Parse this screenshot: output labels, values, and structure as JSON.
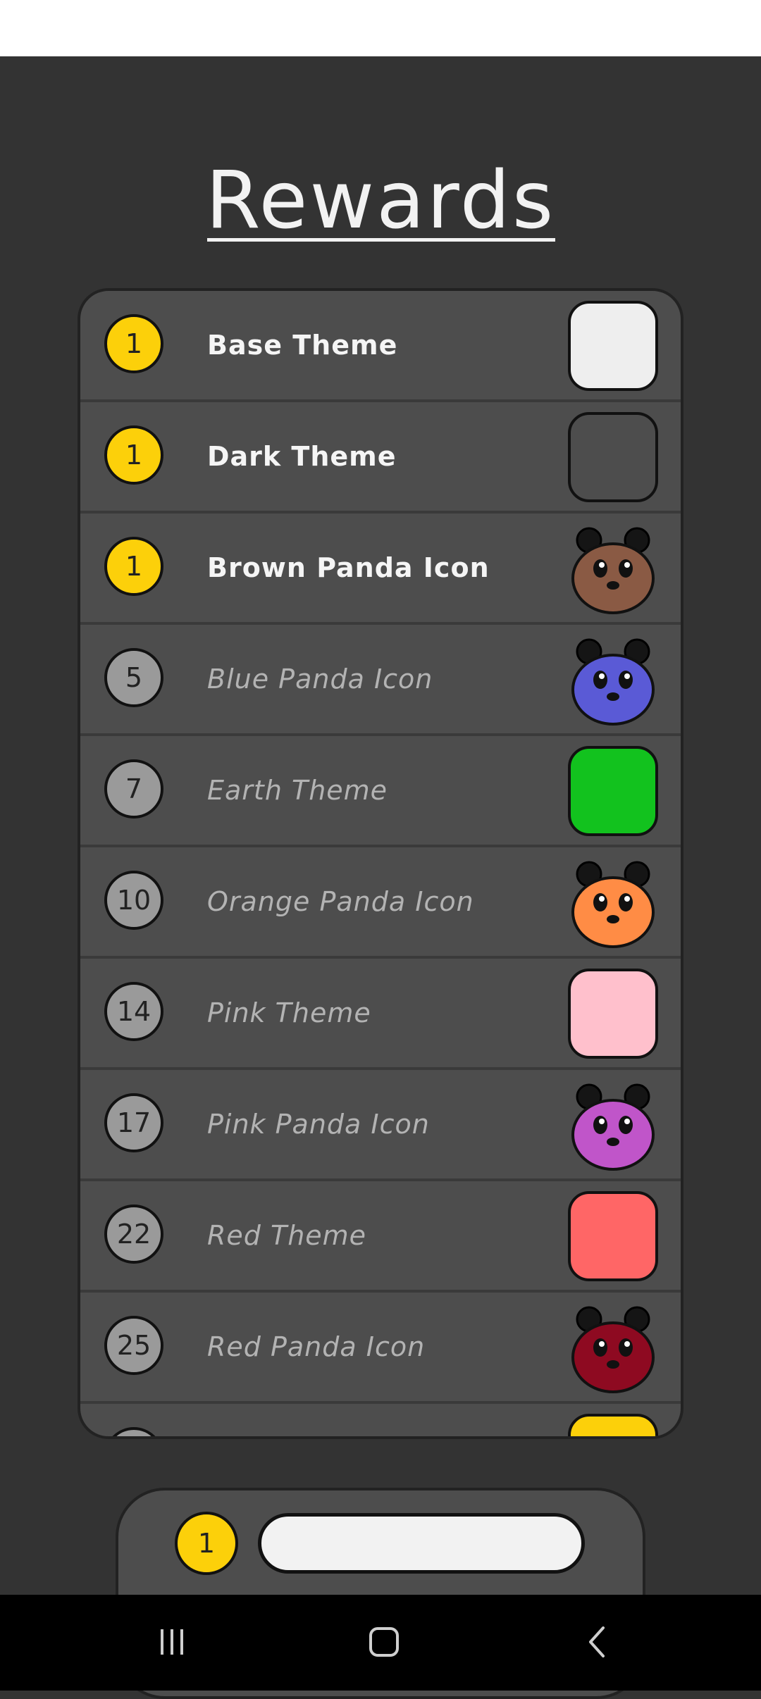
{
  "header": {
    "title": "Rewards"
  },
  "rewards": [
    {
      "cost": "1",
      "label": "Base Theme",
      "unlocked": true,
      "kind": "theme",
      "color": "#eeeeee"
    },
    {
      "cost": "1",
      "label": "Dark Theme",
      "unlocked": true,
      "kind": "theme",
      "color": "#4d4d4d"
    },
    {
      "cost": "1",
      "label": "Brown Panda Icon",
      "unlocked": true,
      "kind": "panda",
      "color": "#8a5a44"
    },
    {
      "cost": "5",
      "label": "Blue Panda Icon",
      "unlocked": false,
      "kind": "panda",
      "color": "#5a5ad6"
    },
    {
      "cost": "7",
      "label": "Earth Theme",
      "unlocked": false,
      "kind": "theme",
      "color": "#12c21e"
    },
    {
      "cost": "10",
      "label": "Orange Panda Icon",
      "unlocked": false,
      "kind": "panda",
      "color": "#ff8c45"
    },
    {
      "cost": "14",
      "label": "Pink Theme",
      "unlocked": false,
      "kind": "theme",
      "color": "#ffc0cc"
    },
    {
      "cost": "17",
      "label": "Pink Panda Icon",
      "unlocked": false,
      "kind": "panda",
      "color": "#c055c9"
    },
    {
      "cost": "22",
      "label": "Red Theme",
      "unlocked": false,
      "kind": "theme",
      "color": "#ff6666"
    },
    {
      "cost": "25",
      "label": "Red Panda Icon",
      "unlocked": false,
      "kind": "panda",
      "color": "#8e0a21"
    },
    {
      "cost": "",
      "label": "",
      "unlocked": false,
      "kind": "theme",
      "color": "#fcd00a"
    }
  ],
  "footer": {
    "coins": "1",
    "input_value": ""
  },
  "nav": {
    "recents_icon": "recents-icon",
    "home_icon": "home-icon",
    "back_icon": "back-icon"
  }
}
